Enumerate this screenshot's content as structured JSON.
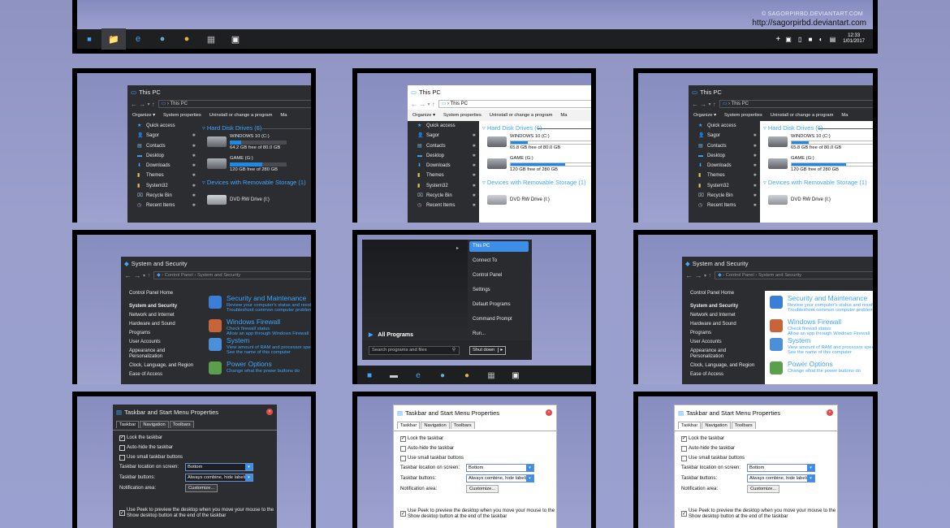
{
  "preview_top": {
    "watermark": "© SAGORPIRBD.DEVIANTART.COM",
    "url": "http://sagorpirbd.deviantart.com",
    "clock_time": "12:33",
    "clock_date": "1/01/2017",
    "tray_plus": "+"
  },
  "explorer": {
    "title": "This PC",
    "breadcrumb": "This PC",
    "toolbar": [
      "Organize ▾",
      "System properties",
      "Uninstall or change a program",
      "Ma"
    ],
    "sidebar": [
      "Quick access",
      "Sagor",
      "Contacts",
      "Desktop",
      "Downloads",
      "Themes",
      "System32",
      "Recycle Bin",
      "Recent Items"
    ],
    "section_hdd": "Hard Disk Drives (6)",
    "section_removable": "Devices with Removable Storage (1)",
    "dark_drives": [
      {
        "name": "WINDOWS 10 (C:)",
        "free": "64.2 GB free of 80.0 GB",
        "fill": 0.2
      },
      {
        "name": "GAME (G:)",
        "free": "120 GB free of 280 GB",
        "fill": 0.57
      }
    ],
    "light_drives": [
      {
        "name": "WINDOWS 10 (C:)",
        "free": "65.8 GB free of 80.0 GB",
        "fill": 0.18
      },
      {
        "name": "GAME (G:)",
        "free": "120 GB free of 280 GB",
        "fill": 0.57
      }
    ],
    "dvd": "DVD RW Drive (I:)"
  },
  "control_panel": {
    "title": "System and Security",
    "breadcrumb_root": "Control Panel",
    "breadcrumb_leaf": "System and Security",
    "sidebar": [
      "Control Panel Home",
      "System and Security",
      "Network and Internet",
      "Hardware and Sound",
      "Programs",
      "User Accounts",
      "Appearance and Personalization",
      "Clock, Language, and Region",
      "Ease of Access"
    ],
    "items": [
      {
        "title": "Security and Maintenance",
        "sub": "Review your computer's status and resolve issues",
        "sub2": "Troubleshoot common computer problems"
      },
      {
        "title": "Windows Firewall",
        "sub": "Check firewall status",
        "sub2": "Allow an app through Windows Firewall"
      },
      {
        "title": "System",
        "sub": "View amount of RAM and processor speed",
        "sub2": "See the name of this computer"
      },
      {
        "title": "Power Options",
        "sub": "Change what the power buttons do",
        "sub2": ""
      }
    ]
  },
  "start_menu": {
    "items": [
      "This PC",
      "Connect To",
      "Control Panel",
      "Settings",
      "Default Programs",
      "Command Prompt",
      "Run..."
    ],
    "all_programs": "All Programs",
    "search_placeholder": "Search programs and files",
    "shutdown": "Shut down"
  },
  "taskbar_dialog": {
    "title": "Taskbar and Start Menu Properties",
    "tabs": [
      "Taskbar",
      "Navigation",
      "Toolbars"
    ],
    "lock": "Lock the taskbar",
    "autohide": "Auto-hide the taskbar",
    "small": "Use small taskbar buttons",
    "location_label": "Taskbar location on screen:",
    "location_value": "Bottom",
    "buttons_label": "Taskbar buttons:",
    "buttons_value": "Always combine, hide labels",
    "notif_label": "Notification area:",
    "customize": "Customize...",
    "peek": "Use Peek to preview the desktop when you move your mouse to the",
    "peek2": "Show desktop button at the end of the taskbar"
  },
  "colors": {
    "accent": "#1e88e5",
    "dark": "#2c2d30",
    "taskbar": "#1e1f21",
    "link": "#3ea6ff"
  }
}
